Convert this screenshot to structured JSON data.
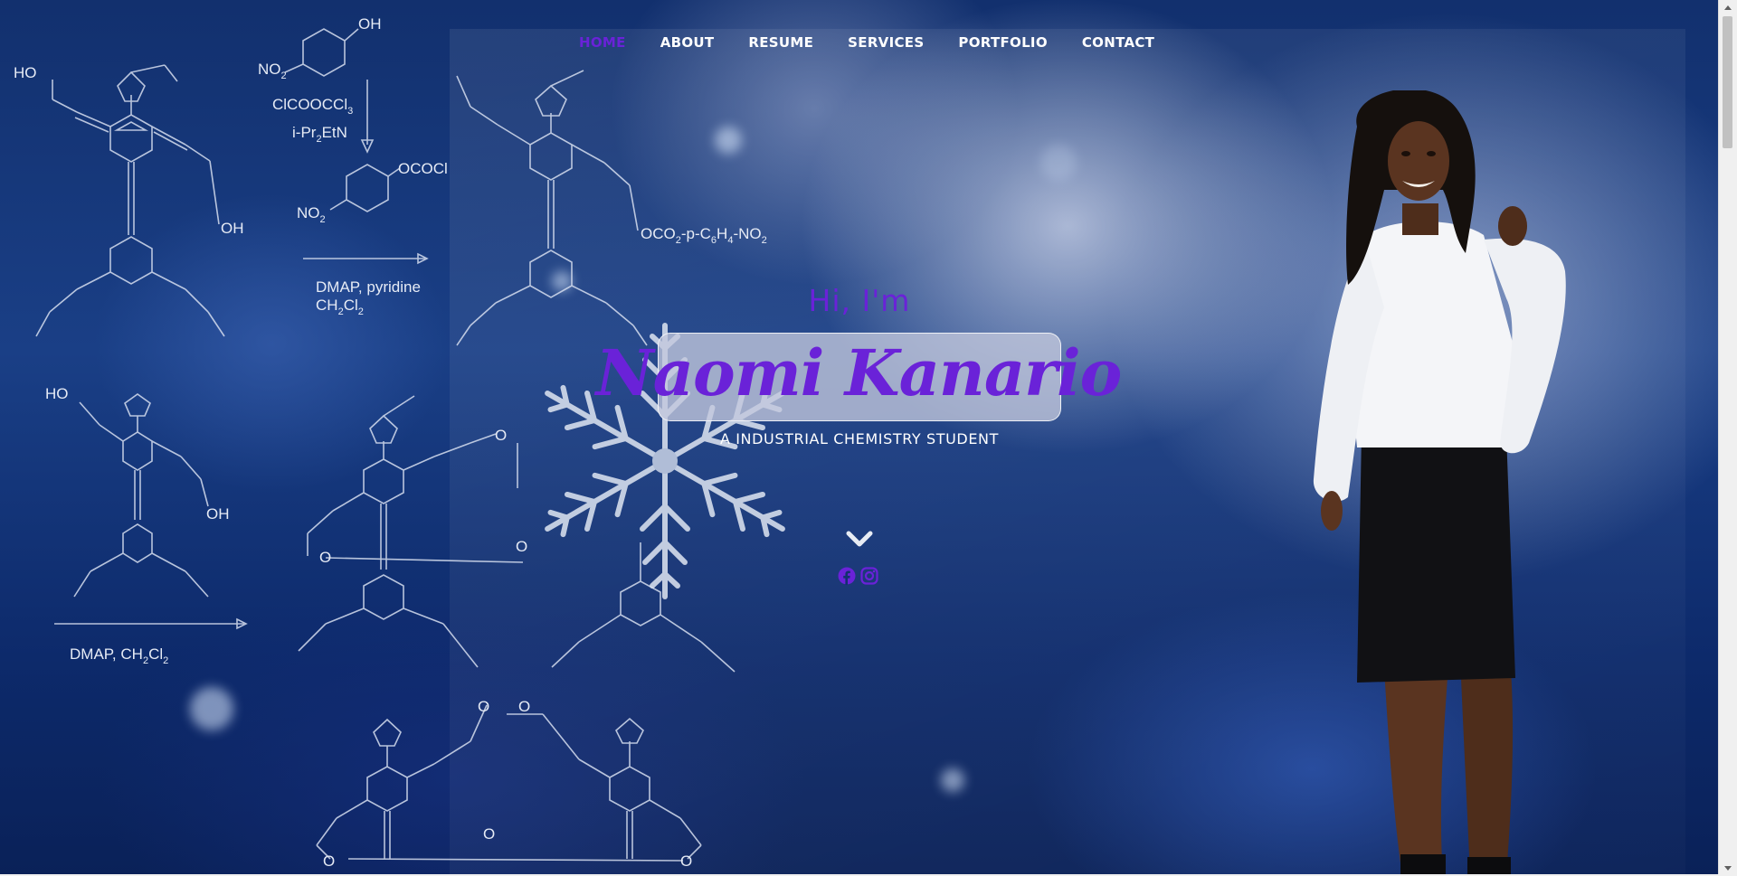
{
  "nav": {
    "items": [
      {
        "label": "HOME",
        "active": true
      },
      {
        "label": "ABOUT",
        "active": false
      },
      {
        "label": "RESUME",
        "active": false
      },
      {
        "label": "SERVICES",
        "active": false
      },
      {
        "label": "PORTFOLIO",
        "active": false
      },
      {
        "label": "CONTACT",
        "active": false
      }
    ]
  },
  "hero": {
    "greeting": "Hi, I'm",
    "name": "Naomi Kanario",
    "subtitle": "A INDUSTRIAL CHEMISTRY STUDENT"
  },
  "chemistry": {
    "labels": {
      "oh_top": "OH",
      "no2_top": "NO",
      "no2_top_sub": "2",
      "reagent_1": "ClCOOCCl",
      "reagent_1_sub": "3",
      "reagent_2": "i-Pr",
      "reagent_2_sub": "2",
      "reagent_2_end": "EtN",
      "ococl": "OCOCl",
      "no2_mid": "NO",
      "no2_mid_sub": "2",
      "dmap_pyridine": "DMAP, pyridine",
      "ch2cl2": "CH",
      "ch2cl2_sub1": "2",
      "ch2cl2_cl": "Cl",
      "ch2cl2_sub2": "2",
      "ho_left": "HO",
      "oh_right": "OH",
      "oco2": "OCO",
      "oco2_sub": "2",
      "oco2_tail": "-p-C",
      "oco2_sub6": "6",
      "oco2_h": "H",
      "oco2_sub4": "4",
      "oco2_no2": "-NO",
      "oco2_sub2b": "2",
      "ho_mid": "HO",
      "oh_mid": "OH",
      "dmap_ch2cl2": "DMAP, CH",
      "dmap_ch2cl2_sub": "2",
      "dmap_ch2cl2_cl": "Cl",
      "dmap_ch2cl2_sub2": "2",
      "o_atom": "O"
    }
  },
  "social": {
    "icons": [
      "facebook-icon",
      "instagram-icon"
    ]
  },
  "colors": {
    "accent": "#6a22d8",
    "nav_text": "#ffffff",
    "background_dark": "#0b1a45"
  }
}
